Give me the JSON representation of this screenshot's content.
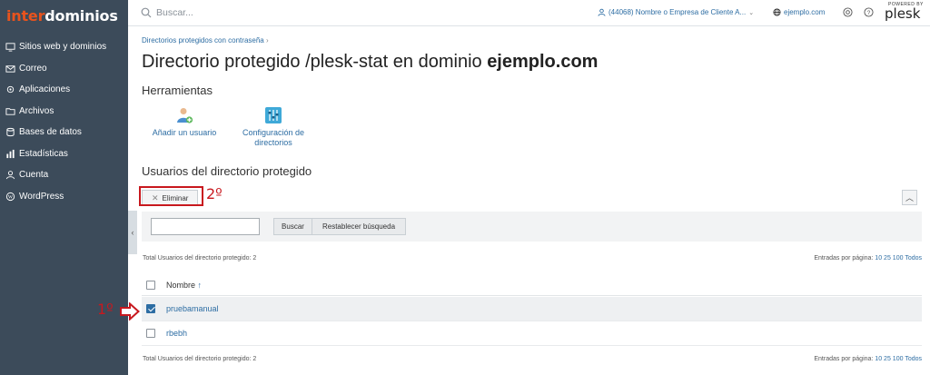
{
  "brand": {
    "logo_part1": "inter",
    "logo_part2": "dominios"
  },
  "sidebar": {
    "items": [
      {
        "label": "Sitios web y dominios",
        "icon": "monitor-icon"
      },
      {
        "label": "Correo",
        "icon": "mail-icon"
      },
      {
        "label": "Aplicaciones",
        "icon": "gear-icon"
      },
      {
        "label": "Archivos",
        "icon": "folder-icon"
      },
      {
        "label": "Bases de datos",
        "icon": "database-icon"
      },
      {
        "label": "Estadísticas",
        "icon": "chart-icon"
      },
      {
        "label": "Cuenta",
        "icon": "user-icon"
      },
      {
        "label": "WordPress",
        "icon": "wordpress-icon"
      }
    ]
  },
  "topbar": {
    "search_placeholder": "Buscar...",
    "account": "(44068) Nombre o Empresa de Cliente A...",
    "domain": "ejemplo.com",
    "powered_by": "POWERED BY",
    "plesk": "plesk"
  },
  "breadcrumb": "Directorios protegidos con contraseña",
  "title": {
    "prefix": "Directorio protegido /plesk-stat en dominio ",
    "domain": "ejemplo.com"
  },
  "tools": {
    "heading": "Herramientas",
    "items": [
      {
        "label": "Añadir un usuario",
        "icon": "add-user-icon"
      },
      {
        "label_line1": "Configuración de",
        "label_line2": "directorios",
        "icon": "settings-sliders-icon"
      }
    ]
  },
  "users": {
    "heading": "Usuarios del directorio protegido",
    "delete_label": "Eliminar",
    "search_button": "Buscar",
    "reset_button": "Restablecer búsqueda",
    "total_text": "Total Usuarios del directorio protegido: 2",
    "perpage_label": "Entradas por página: ",
    "perpage_options": [
      "10",
      "25",
      "100",
      "Todos"
    ],
    "column_name": "Nombre",
    "sort_arrow": "↑",
    "rows": [
      {
        "name": "pruebamanual",
        "checked": true
      },
      {
        "name": "rbebh",
        "checked": false
      }
    ]
  },
  "annotations": {
    "step1": "1º",
    "step2": "2º"
  },
  "colors": {
    "sidebar": "#3c4b5a",
    "link": "#2d6da3",
    "annotation": "#c8181e",
    "brand_orange": "#e8531d"
  }
}
